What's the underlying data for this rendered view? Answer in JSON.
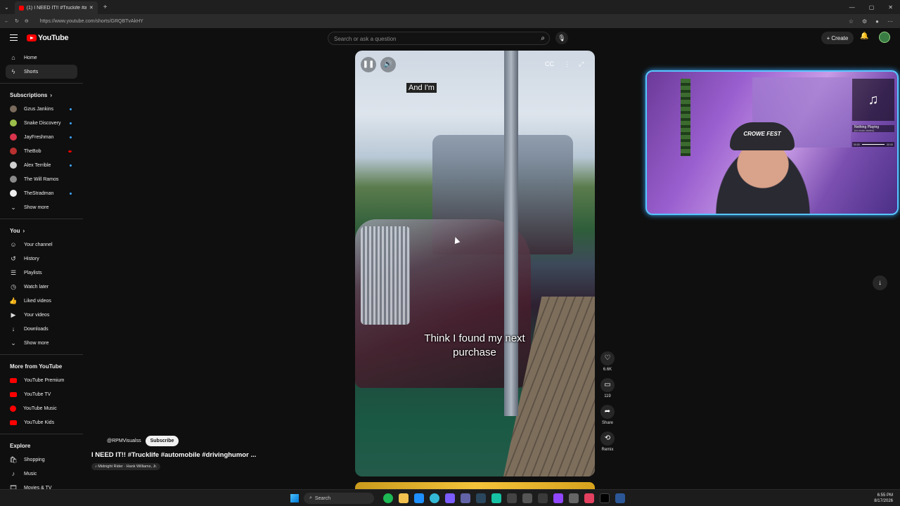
{
  "browser": {
    "tab_title": "(1) I NEED IT!! #Truckife #autom",
    "url": "https://www.youtube.com/shorts/GRQBTvAkHY",
    "new_tab": "+",
    "window_controls": [
      "—",
      "▢",
      "✕"
    ]
  },
  "header": {
    "logo_text": "YouTube",
    "search_placeholder": "Search or ask a question",
    "create_label": "Create"
  },
  "sidebar": {
    "main": [
      {
        "label": "Home",
        "icon": "home-icon"
      },
      {
        "label": "Shorts",
        "icon": "shorts-icon",
        "active": true
      }
    ],
    "subscriptions_title": "Subscriptions",
    "subscriptions": [
      {
        "label": "Gzus Jankins",
        "color": "#7a6a5c"
      },
      {
        "label": "Snake Discovery",
        "color": "#9bbf4a"
      },
      {
        "label": "JayFreshman",
        "color": "#d9344c"
      },
      {
        "label": "TheBob",
        "color": "#b8302f"
      },
      {
        "label": "Alex Terrible",
        "color": "#d0d0d0"
      },
      {
        "label": "The Will Ramos",
        "color": "#8a8a8a"
      },
      {
        "label": "TheStradman",
        "color": "#eeeeee"
      }
    ],
    "show_more_1": "Show more",
    "you_title": "You",
    "you_items": [
      {
        "label": "Your channel",
        "icon": "user-icon"
      },
      {
        "label": "History",
        "icon": "history-icon"
      },
      {
        "label": "Playlists",
        "icon": "playlist-icon"
      },
      {
        "label": "Watch later",
        "icon": "clock-icon"
      },
      {
        "label": "Liked videos",
        "icon": "thumb-up-icon"
      },
      {
        "label": "Your videos",
        "icon": "video-icon"
      },
      {
        "label": "Downloads",
        "icon": "download-icon"
      }
    ],
    "show_more_2": "Show more",
    "more_title": "More from YouTube",
    "more_items": [
      "YouTube Premium",
      "YouTube TV",
      "YouTube Music",
      "YouTube Kids"
    ],
    "explore_title": "Explore",
    "explore_items": [
      {
        "label": "Shopping",
        "icon": "bag-icon"
      },
      {
        "label": "Music",
        "icon": "music-note-icon"
      },
      {
        "label": "Movies & TV",
        "icon": "film-icon"
      }
    ]
  },
  "short": {
    "caption_top": "And I'm",
    "caption_main": "Think I found my next purchase",
    "channel_handle": "@RPMVisualss",
    "subscribe_label": "Subscribe",
    "title": "I NEED IT!! #Trucklife #automobile #drivinghumor ...",
    "music": "♪ Midnight Rider · Hank Williams, Jr.",
    "actions": {
      "likes": "6.6K",
      "comments": "119",
      "share": "Share",
      "remix": "Remix"
    }
  },
  "overlay": {
    "hat_text": "CROWE FEST",
    "now_playing_title": "Nothing Playing",
    "now_playing_sub": "(no music started)",
    "time_start": "00:00",
    "time_end": "00:00"
  },
  "taskbar": {
    "search_label": "Search",
    "time": "6:55 PM",
    "date": "8/17/2026"
  }
}
